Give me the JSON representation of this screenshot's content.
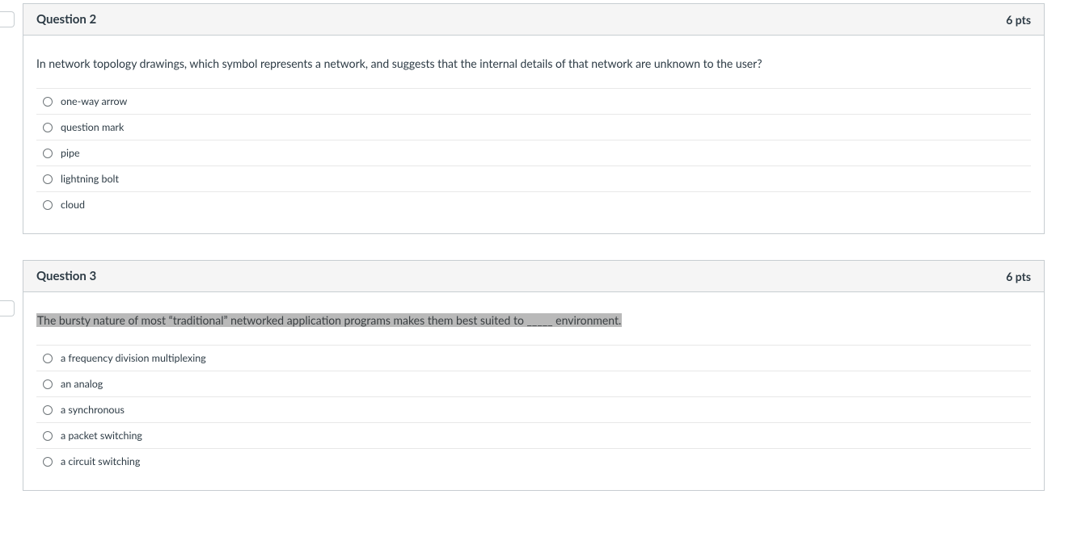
{
  "questions": [
    {
      "title": "Question 2",
      "points": "6 pts",
      "prompt_highlighted": false,
      "prompt": "In network topology drawings, which symbol represents a network, and suggests that the internal details of that network are unknown to the user?",
      "answers": [
        "one-way arrow",
        "question mark",
        "pipe",
        "lightning bolt",
        "cloud"
      ]
    },
    {
      "title": "Question 3",
      "points": "6 pts",
      "prompt_highlighted": true,
      "prompt": "The bursty nature of most “traditional” networked application programs makes them best suited to _____ environment.",
      "answers": [
        "a frequency division multiplexing",
        "an analog",
        "a synchronous",
        "a packet switching",
        "a circuit switching"
      ]
    }
  ],
  "tab_offsets": [
    14,
    372
  ]
}
